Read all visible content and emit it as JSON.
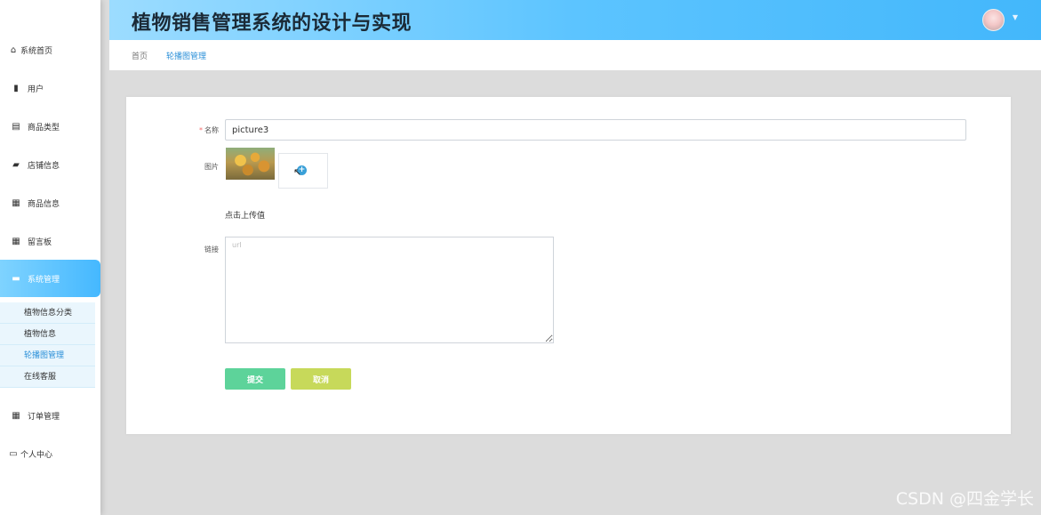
{
  "header": {
    "title": "植物销售管理系统的设计与实现"
  },
  "breadcrumb": {
    "home": "首页",
    "current": "轮播图管理"
  },
  "sidebar": {
    "items": [
      {
        "label": "系统首页",
        "icon": "home-icon"
      },
      {
        "label": "用户",
        "icon": "bar-chart-icon"
      },
      {
        "label": "商品类型",
        "icon": "document-icon"
      },
      {
        "label": "店铺信息",
        "icon": "thumbs-up-icon"
      },
      {
        "label": "商品信息",
        "icon": "grid-icon"
      },
      {
        "label": "留言板",
        "icon": "grid-icon"
      },
      {
        "label": "系统管理",
        "icon": "monitor-icon"
      },
      {
        "label": "订单管理",
        "icon": "grid-icon"
      },
      {
        "label": "个人中心",
        "icon": "id-card-icon"
      }
    ],
    "submenu": [
      {
        "label": "植物信息分类"
      },
      {
        "label": "植物信息"
      },
      {
        "label": "轮播图管理"
      },
      {
        "label": "在线客服"
      }
    ]
  },
  "form": {
    "name_label": "名称",
    "name_required": "*",
    "name_value": "picture3",
    "image_label": "图片",
    "upload_hint": "点击上传值",
    "link_label": "链接",
    "link_placeholder": "url",
    "submit_label": "提交",
    "cancel_label": "取消"
  },
  "watermark": "CSDN @四金学长",
  "colors": {
    "accent": "#45b8ff",
    "submit": "#5dd39a",
    "cancel": "#c7d95a",
    "required": "#f56c6c"
  }
}
